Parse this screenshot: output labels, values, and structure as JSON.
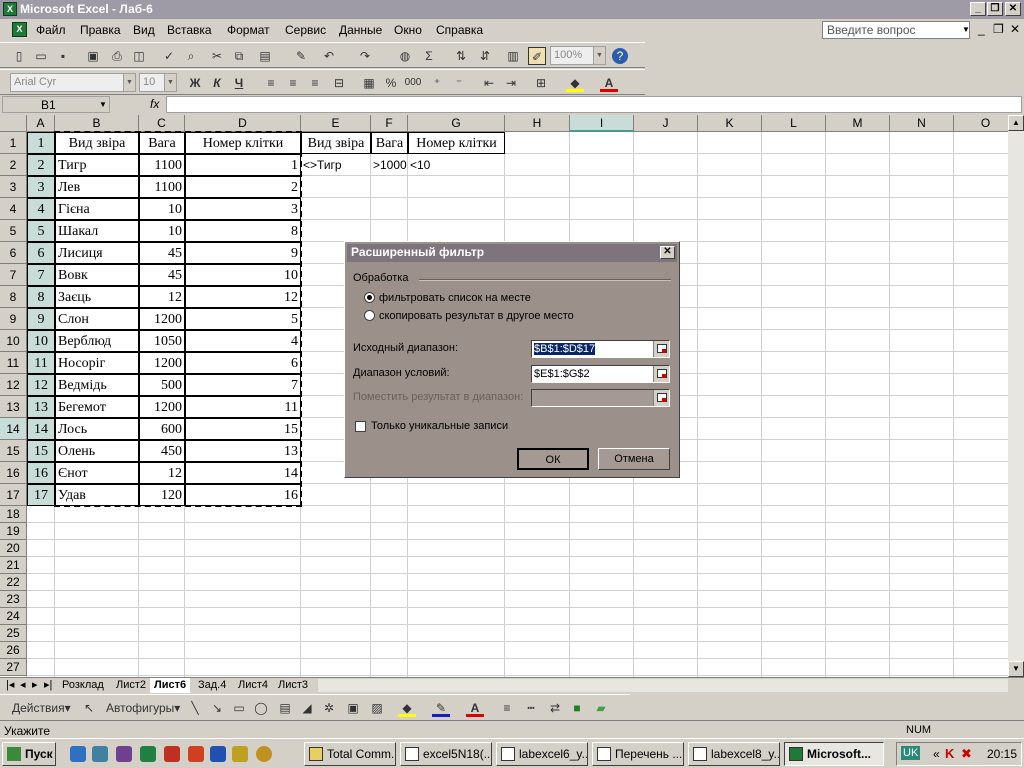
{
  "window": {
    "title": "Microsoft Excel - Лаб-6"
  },
  "menu": {
    "items": [
      "Файл",
      "Правка",
      "Вид",
      "Вставка",
      "Формат",
      "Сервис",
      "Данные",
      "Окно",
      "Справка"
    ],
    "ask_placeholder": "Введите вопрос"
  },
  "toolbar": {
    "zoom": "100%",
    "font": "Arial Cyr",
    "font_size": "10",
    "bold": "Ж",
    "italic": "К",
    "underline": "Ч",
    "percent": "%",
    "thousands": "000"
  },
  "formula_bar": {
    "name_box": "B1",
    "fx": "fx",
    "value": ""
  },
  "sheet": {
    "columns": [
      "A",
      "B",
      "C",
      "D",
      "E",
      "F",
      "G",
      "H",
      "I",
      "J",
      "K",
      "L",
      "M",
      "N",
      "O"
    ],
    "rows": [
      "1",
      "2",
      "3",
      "4",
      "5",
      "6",
      "7",
      "8",
      "9",
      "10",
      "11",
      "12",
      "13",
      "14",
      "15",
      "16",
      "17",
      "18",
      "19",
      "20",
      "21",
      "22",
      "23",
      "24",
      "25",
      "26",
      "27"
    ],
    "header_row": {
      "A": "1",
      "B": "Вид звіра",
      "C": "Вага",
      "D": "Номер клітки"
    },
    "data": [
      {
        "A": "2",
        "B": "Тигр",
        "C": "1100",
        "D": "1"
      },
      {
        "A": "3",
        "B": "Лев",
        "C": "1100",
        "D": "2"
      },
      {
        "A": "4",
        "B": "Гієна",
        "C": "10",
        "D": "3"
      },
      {
        "A": "5",
        "B": "Шакал",
        "C": "10",
        "D": "8"
      },
      {
        "A": "6",
        "B": "Лисиця",
        "C": "45",
        "D": "9"
      },
      {
        "A": "7",
        "B": "Вовк",
        "C": "45",
        "D": "10"
      },
      {
        "A": "8",
        "B": "Заєць",
        "C": "12",
        "D": "12"
      },
      {
        "A": "9",
        "B": "Слон",
        "C": "1200",
        "D": "5"
      },
      {
        "A": "10",
        "B": "Верблюд",
        "C": "1050",
        "D": "4"
      },
      {
        "A": "11",
        "B": "Носоріг",
        "C": "1200",
        "D": "6"
      },
      {
        "A": "12",
        "B": "Ведмідь",
        "C": "500",
        "D": "7"
      },
      {
        "A": "13",
        "B": "Бегемот",
        "C": "1200",
        "D": "11"
      },
      {
        "A": "14",
        "B": "Лось",
        "C": "600",
        "D": "15"
      },
      {
        "A": "15",
        "B": "Олень",
        "C": "450",
        "D": "13"
      },
      {
        "A": "16",
        "B": "Єнот",
        "C": "12",
        "D": "14"
      },
      {
        "A": "17",
        "B": "Удав",
        "C": "120",
        "D": "16"
      }
    ],
    "criteria_header": {
      "E": "Вид звіра",
      "F": "Вага",
      "G": "Номер клітки"
    },
    "criteria": {
      "E": "<>Тигр",
      "F": ">1000",
      "G": "<10"
    }
  },
  "sheet_tabs": [
    "Розклад",
    "Лист2",
    "Лист6",
    "Зад.4",
    "Лист4",
    "Лист3"
  ],
  "active_tab": "Лист6",
  "drawing_bar": {
    "actions": "Действия",
    "autoshapes": "Автофигуры"
  },
  "status": {
    "mode": "Укажите",
    "num": "NUM"
  },
  "dialog": {
    "title": "Расширенный фильтр",
    "group": "Обработка",
    "radio1": "фильтровать список на месте",
    "radio2": "скопировать результат в другое место",
    "source_label": "Исходный диапазон:",
    "source_value": "$B$1:$D$17",
    "criteria_label": "Диапазон условий:",
    "criteria_value": "$E$1:$G$2",
    "dest_label": "Поместить результат в диапазон:",
    "unique_label": "Только уникальные записи",
    "ok": "ОК",
    "cancel": "Отмена"
  },
  "taskbar": {
    "start": "Пуск",
    "windows": [
      "Total Comm...",
      "excel5N18(...",
      "labexcel6_y...",
      "Перечень ...",
      "labexcel8_y...",
      "Microsoft..."
    ],
    "lang": "UK",
    "clock": "20:15"
  }
}
